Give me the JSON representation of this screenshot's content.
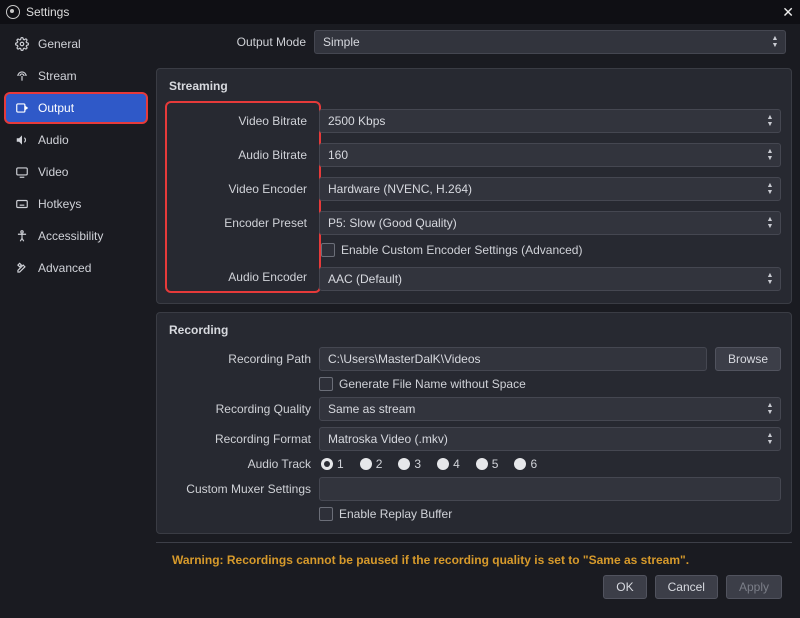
{
  "window": {
    "title": "Settings"
  },
  "sidebar": {
    "items": [
      {
        "label": "General"
      },
      {
        "label": "Stream"
      },
      {
        "label": "Output"
      },
      {
        "label": "Audio"
      },
      {
        "label": "Video"
      },
      {
        "label": "Hotkeys"
      },
      {
        "label": "Accessibility"
      },
      {
        "label": "Advanced"
      }
    ]
  },
  "outputMode": {
    "label": "Output Mode",
    "value": "Simple"
  },
  "streaming": {
    "title": "Streaming",
    "videoBitrate": {
      "label": "Video Bitrate",
      "value": "2500 Kbps"
    },
    "audioBitrate": {
      "label": "Audio Bitrate",
      "value": "160"
    },
    "videoEncoder": {
      "label": "Video Encoder",
      "value": "Hardware (NVENC, H.264)"
    },
    "encoderPreset": {
      "label": "Encoder Preset",
      "value": "P5: Slow (Good Quality)"
    },
    "customEncoder": {
      "label": "Enable Custom Encoder Settings (Advanced)"
    },
    "audioEncoder": {
      "label": "Audio Encoder",
      "value": "AAC (Default)"
    }
  },
  "recording": {
    "title": "Recording",
    "path": {
      "label": "Recording Path",
      "value": "C:\\Users\\MasterDalK\\Videos",
      "browse": "Browse"
    },
    "genFilename": {
      "label": "Generate File Name without Space"
    },
    "quality": {
      "label": "Recording Quality",
      "value": "Same as stream"
    },
    "format": {
      "label": "Recording Format",
      "value": "Matroska Video (.mkv)"
    },
    "audioTrack": {
      "label": "Audio Track",
      "t1": "1",
      "t2": "2",
      "t3": "3",
      "t4": "4",
      "t5": "5",
      "t6": "6"
    },
    "muxer": {
      "label": "Custom Muxer Settings",
      "value": ""
    },
    "replay": {
      "label": "Enable Replay Buffer"
    }
  },
  "warning": "Warning: Recordings cannot be paused if the recording quality is set to \"Same as stream\".",
  "buttons": {
    "ok": "OK",
    "cancel": "Cancel",
    "apply": "Apply"
  }
}
